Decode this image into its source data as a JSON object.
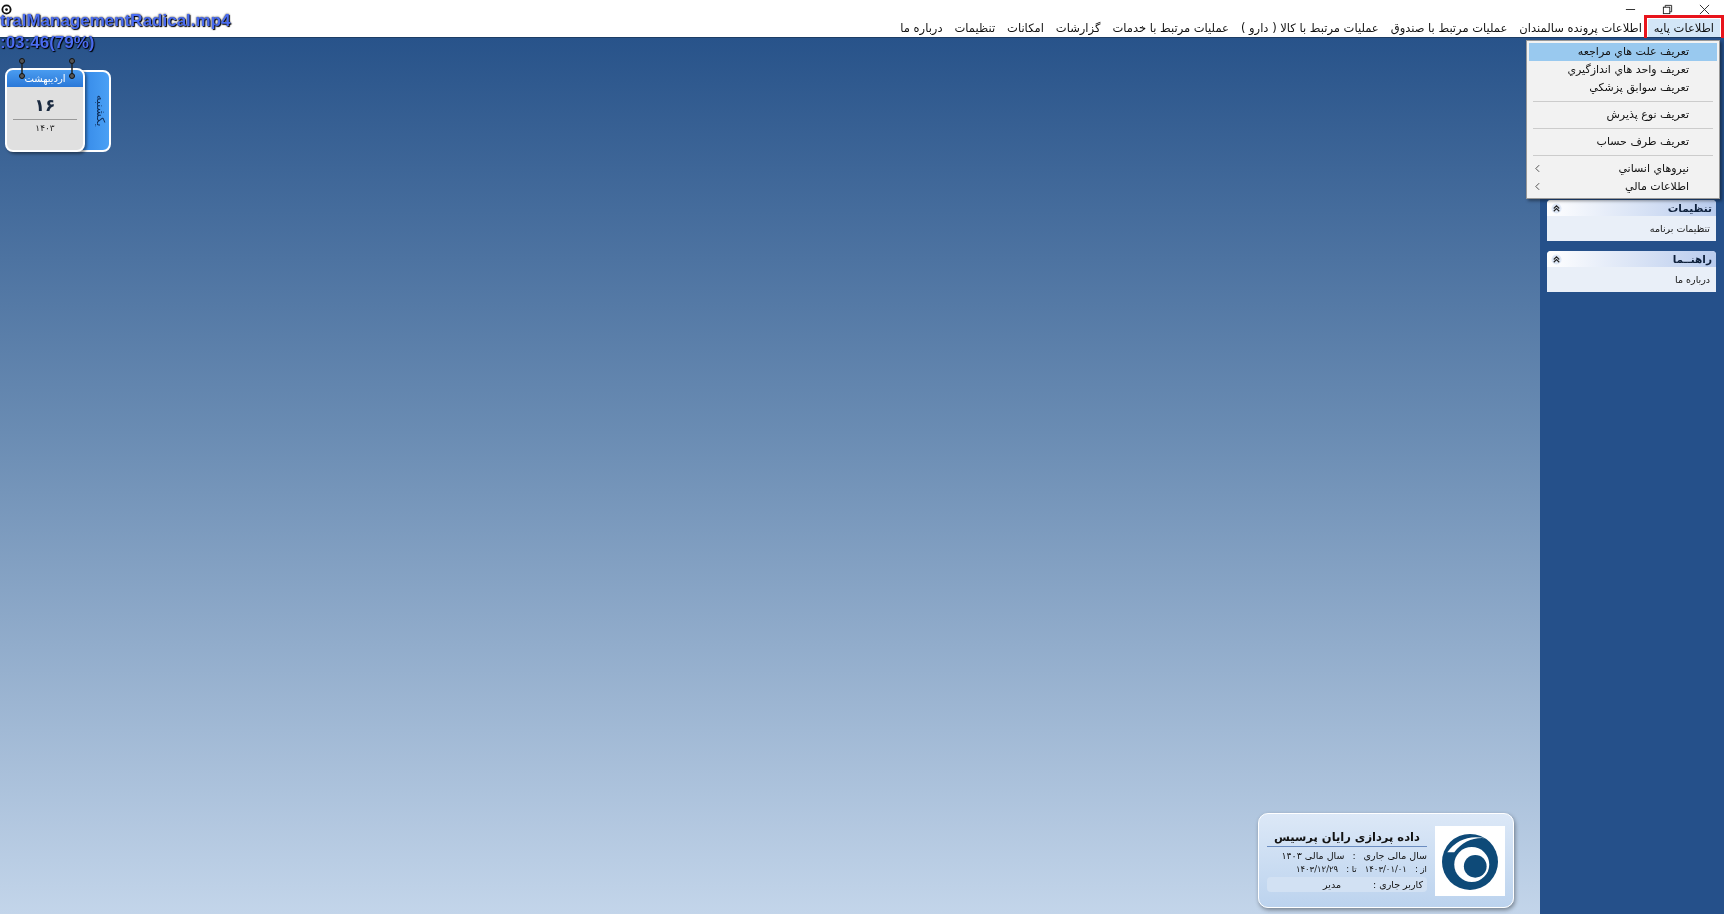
{
  "overlay": {
    "file_name": "tralManagementRadical.mp4",
    "progress": ":03:46(79%)"
  },
  "menu_bar": [
    {
      "label": "اطلاعات پایه",
      "selected": true
    },
    {
      "label": "اطلاعات پرونده سالمندان",
      "selected": false
    },
    {
      "label": "عملیات مرتبط با صندوق",
      "selected": false
    },
    {
      "label": "عملیات مرتبط با کالا ( دارو )",
      "selected": false
    },
    {
      "label": "عملیات مرتبط با خدمات",
      "selected": false
    },
    {
      "label": "گزارشات",
      "selected": false
    },
    {
      "label": "امکانات",
      "selected": false
    },
    {
      "label": "تنظیمات",
      "selected": false
    },
    {
      "label": "درباره ما",
      "selected": false
    }
  ],
  "dropdown": [
    {
      "kind": "item",
      "label": "تعریف علت هاي مراجعه",
      "selected": true
    },
    {
      "kind": "item",
      "label": "تعریف واحد هاي اندازگيري",
      "selected": false
    },
    {
      "kind": "item",
      "label": "تعریف سوابق پزشكي",
      "selected": false
    },
    {
      "kind": "separator"
    },
    {
      "kind": "item",
      "label": "تعریف نوع پذيرش",
      "selected": false
    },
    {
      "kind": "separator"
    },
    {
      "kind": "item",
      "label": "تعریف طرف حساب",
      "selected": false
    },
    {
      "kind": "separator"
    },
    {
      "kind": "submenu",
      "label": "نيروهاي انساني",
      "selected": false
    },
    {
      "kind": "submenu",
      "label": "اطلاعات مالي",
      "selected": false
    }
  ],
  "calendar": {
    "month": "اردیبهشت",
    "day": "۱۶",
    "year": "۱۴۰۳",
    "weekday": "یکشنبه"
  },
  "sidebar": [
    {
      "title": "تنظیمات",
      "items": [
        "تنظیمات برنامه"
      ]
    },
    {
      "title": "راهنــما",
      "items": [
        "درباره ما"
      ]
    }
  ],
  "company_card": {
    "title": "داده پردازی رایان پرسیس",
    "fiscal_label": "سال مالی جاری",
    "fiscal_sep": ":",
    "fiscal_value": "سال مالی ۱۴۰۳",
    "from_label": "از :",
    "from_date": "۱۴۰۳/۰۱/۰۱",
    "to_label": "تا :",
    "to_date": "۱۴۰۳/۱۲/۲۹",
    "user_label": "کاربر جاری :",
    "user_value": "مدیر"
  }
}
